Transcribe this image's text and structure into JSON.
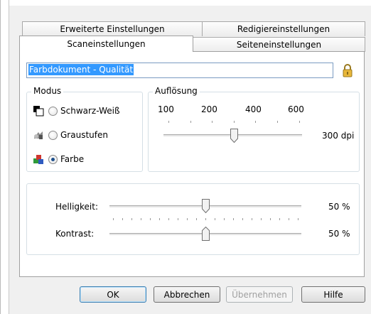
{
  "tabs": {
    "row_back": [
      "Erweiterte Einstellungen",
      "Redigiereinstellungen"
    ],
    "row_front": [
      "Scaneinstellungen",
      "Seiteneinstellungen"
    ],
    "active": "Scaneinstellungen"
  },
  "preset": {
    "value": "Farbdokument - Qualität",
    "lock_icon": "padlock-icon"
  },
  "mode": {
    "title": "Modus",
    "options": [
      {
        "label": "Schwarz-Weiß",
        "icon": "black-white-icon",
        "checked": false
      },
      {
        "label": "Graustufen",
        "icon": "grayscale-icon",
        "checked": false
      },
      {
        "label": "Farbe",
        "icon": "color-icon",
        "checked": true
      }
    ]
  },
  "resolution": {
    "title": "Auflösung",
    "scale_labels": [
      "100",
      "200",
      "400",
      "600"
    ],
    "value_text": "300 dpi"
  },
  "adjust": {
    "brightness": {
      "label": "Helligkeit:",
      "value_text": "50 %",
      "level": 0.5
    },
    "contrast": {
      "label": "Kontrast:",
      "value_text": "50 %",
      "level": 0.5
    }
  },
  "buttons": {
    "ok": "OK",
    "cancel": "Abbrechen",
    "apply": "Übernehmen",
    "help": "Hilfe"
  },
  "colors": {
    "selection": "#3399ff",
    "lock": "#e2b33a"
  }
}
